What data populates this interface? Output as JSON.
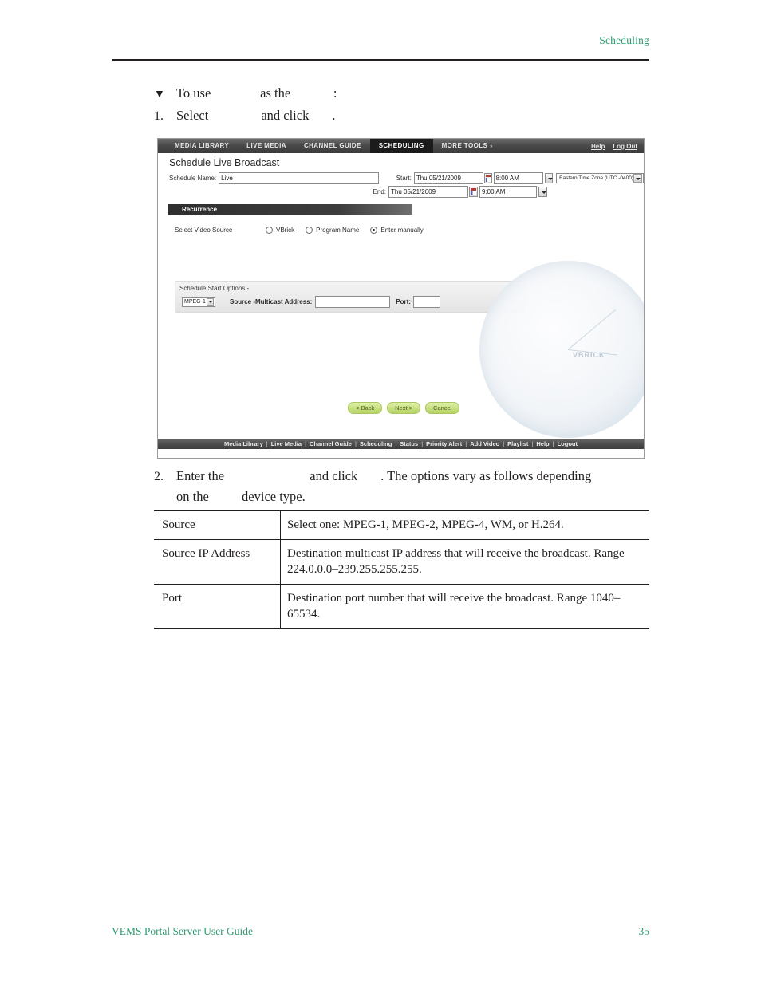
{
  "page_header": {
    "section": "Scheduling"
  },
  "steps": {
    "step0_marker": "▼",
    "step0_parts": [
      "To use",
      "as the",
      ":"
    ],
    "step1_marker": "1.",
    "step1_parts": [
      "Select",
      "and click",
      "."
    ]
  },
  "app": {
    "nav": {
      "tabs": [
        {
          "label": "MEDIA LIBRARY",
          "active": false
        },
        {
          "label": "LIVE MEDIA",
          "active": false
        },
        {
          "label": "CHANNEL GUIDE",
          "active": false
        },
        {
          "label": "SCHEDULING",
          "active": true
        },
        {
          "label": "MORE TOOLS",
          "active": false,
          "caret": "»"
        }
      ],
      "help_label": "Help",
      "logout_label": "Log Out"
    },
    "title": "Schedule Live Broadcast",
    "form": {
      "schedule_name_label": "Schedule Name:",
      "schedule_name_value": "Live",
      "start_label": "Start:",
      "start_date_value": "Thu 05/21/2009",
      "start_time_value": "8:00 AM",
      "end_label": "End:",
      "end_date_value": "Thu 05/21/2009",
      "end_time_value": "9:00 AM",
      "timezone_value": "Eastern Time Zone (UTC -0400)"
    },
    "recurrence_label": "Recurrence",
    "video_source": {
      "label": "Select Video Source",
      "options": [
        {
          "label": "VBrick",
          "selected": false
        },
        {
          "label": "Program Name",
          "selected": false
        },
        {
          "label": "Enter manually",
          "selected": true
        }
      ]
    },
    "start_options": {
      "title": "Schedule Start Options -",
      "source_value": "MPEG-1",
      "address_label": "Source -Multicast Address:",
      "address_value": "",
      "port_label": "Port:",
      "port_value": ""
    },
    "watermark_text": "VBRICK",
    "buttons": [
      {
        "label": "< Back"
      },
      {
        "label": "Next >"
      },
      {
        "label": "Cancel"
      }
    ],
    "footer_links": [
      "Media Library",
      "Live Media",
      "Channel Guide",
      "Scheduling",
      "Status",
      "Priority Alert",
      "Add Video",
      "Playlist",
      "Help",
      "Logout"
    ],
    "footer_separator": "|"
  },
  "step2": {
    "marker": "2.",
    "line1_a": "Enter the",
    "line1_b": "and click",
    "line1_c": ". The options vary as follows depending",
    "line2_a": "on the",
    "line2_b": "device type."
  },
  "table": {
    "rows": [
      {
        "term": "Source",
        "desc": "Select one: MPEG-1, MPEG-2, MPEG-4, WM, or H.264."
      },
      {
        "term": "Source IP Address",
        "desc": "Destination multicast IP address that will receive the broadcast. Range 224.0.0.0–239.255.255.255."
      },
      {
        "term": "Port",
        "desc": "Destination port number that will receive the broadcast. Range 1040–65534."
      }
    ]
  },
  "page_footer": {
    "doc_title": "VEMS Portal Server User Guide",
    "page_number": "35"
  }
}
